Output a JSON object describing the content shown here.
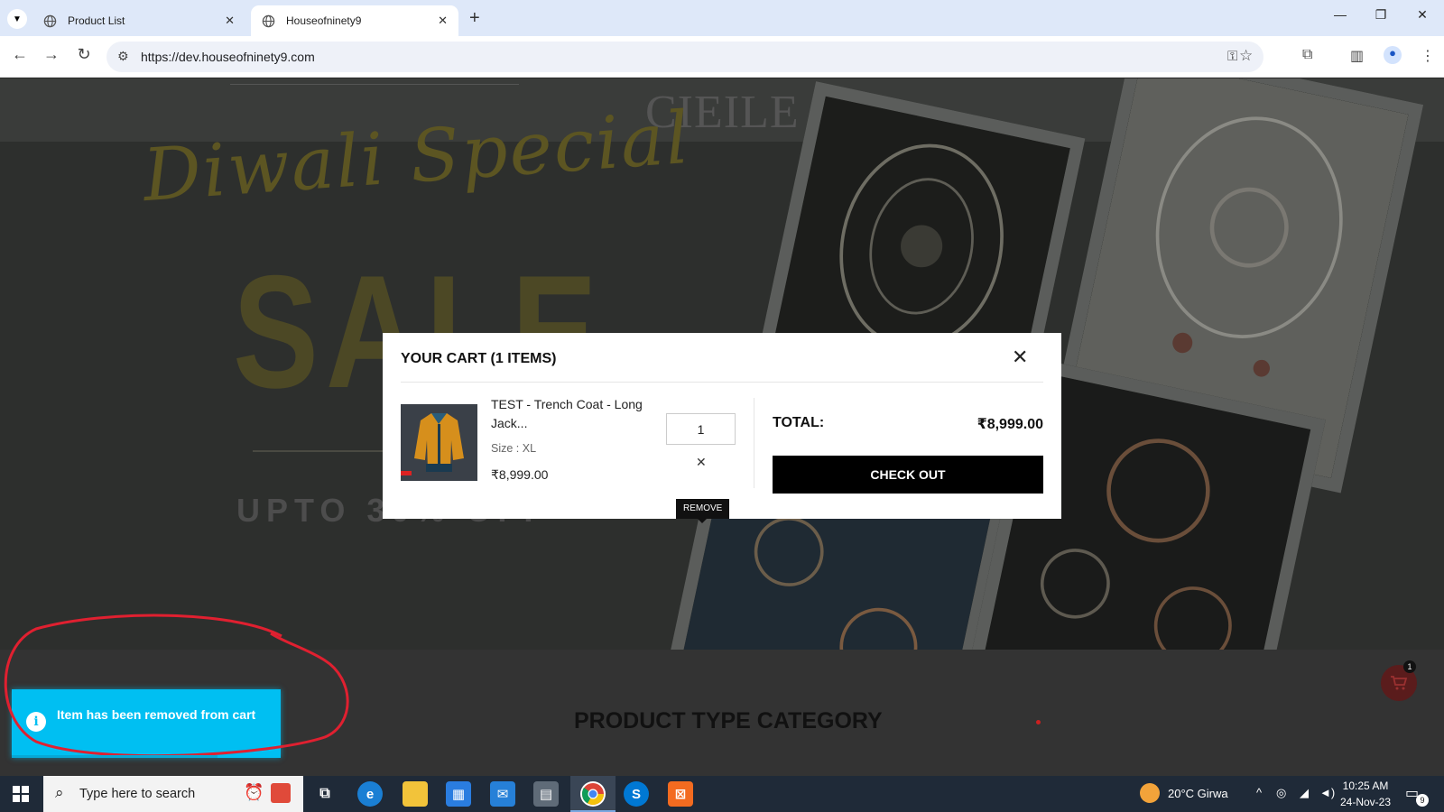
{
  "browser": {
    "tabs": [
      {
        "label": "Product List"
      },
      {
        "label": "Houseofninety9"
      }
    ],
    "url": "https://dev.houseofninety9.com"
  },
  "banner": {
    "brand_logo": "CIEILE",
    "script_text": "Diwali Special",
    "headline": "SALE",
    "subheadline": "UPTO 30% OFF"
  },
  "cart_modal": {
    "title": "YOUR CART (1 ITEMS)",
    "item": {
      "name": "TEST - Trench Coat - Long Jack...",
      "size": "Size : XL",
      "price": "₹8,999.00",
      "quantity": "1"
    },
    "remove_tooltip": "REMOVE",
    "total_label": "TOTAL:",
    "total_value": "₹8,999.00",
    "checkout_label": "CHECK OUT"
  },
  "page": {
    "section_title": "PRODUCT TYPE CATEGORY",
    "cart_badge_count": "1"
  },
  "toast": {
    "message": "Item has been removed from cart",
    "color": "#00bff2"
  },
  "taskbar": {
    "search_placeholder": "Type here to search",
    "weather": "20°C  Girwa",
    "time": "10:25 AM",
    "date": "24-Nov-23",
    "notification_count": "9"
  }
}
